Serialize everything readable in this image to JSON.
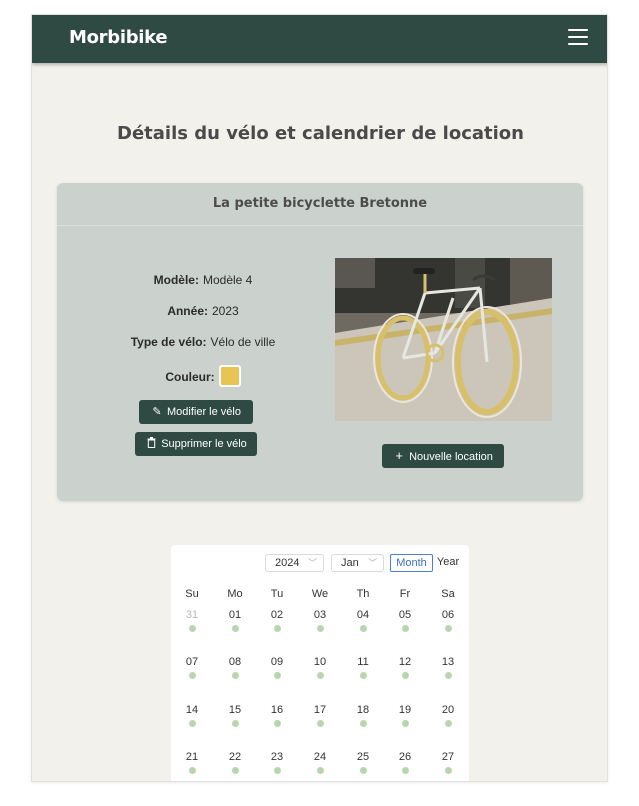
{
  "app": {
    "brand": "Morbibike"
  },
  "page": {
    "title": "Détails du vélo et calendrier de location"
  },
  "bike": {
    "name": "La petite bicyclette Bretonne",
    "details": [
      {
        "label": "Modèle:",
        "value": "Modèle 4"
      },
      {
        "label": "Année:",
        "value": "2023"
      },
      {
        "label": "Type de vélo:",
        "value": "Vélo de ville"
      }
    ],
    "color": {
      "label": "Couleur:",
      "swatch": "#e8c452"
    },
    "edit_label": "Modifier le vélo",
    "delete_label": "Supprimer le vélo",
    "new_rental_label": "Nouvelle location"
  },
  "calendar": {
    "year": "2024",
    "month": "Jan",
    "mode_month": "Month",
    "mode_year": "Year",
    "weekdays": [
      "Su",
      "Mo",
      "Tu",
      "We",
      "Th",
      "Fr",
      "Sa"
    ],
    "weeks": [
      [
        "31",
        "01",
        "02",
        "03",
        "04",
        "05",
        "06"
      ],
      [
        "07",
        "08",
        "09",
        "10",
        "11",
        "12",
        "13"
      ],
      [
        "14",
        "15",
        "16",
        "17",
        "18",
        "19",
        "20"
      ],
      [
        "21",
        "22",
        "23",
        "24",
        "25",
        "26",
        "27"
      ]
    ]
  },
  "colors": {
    "primary": "#2f4a43",
    "card": "#cbd1cc",
    "background": "#f3f1ec",
    "dot": "#b8d6ad",
    "accent": "#3b6fc4"
  }
}
